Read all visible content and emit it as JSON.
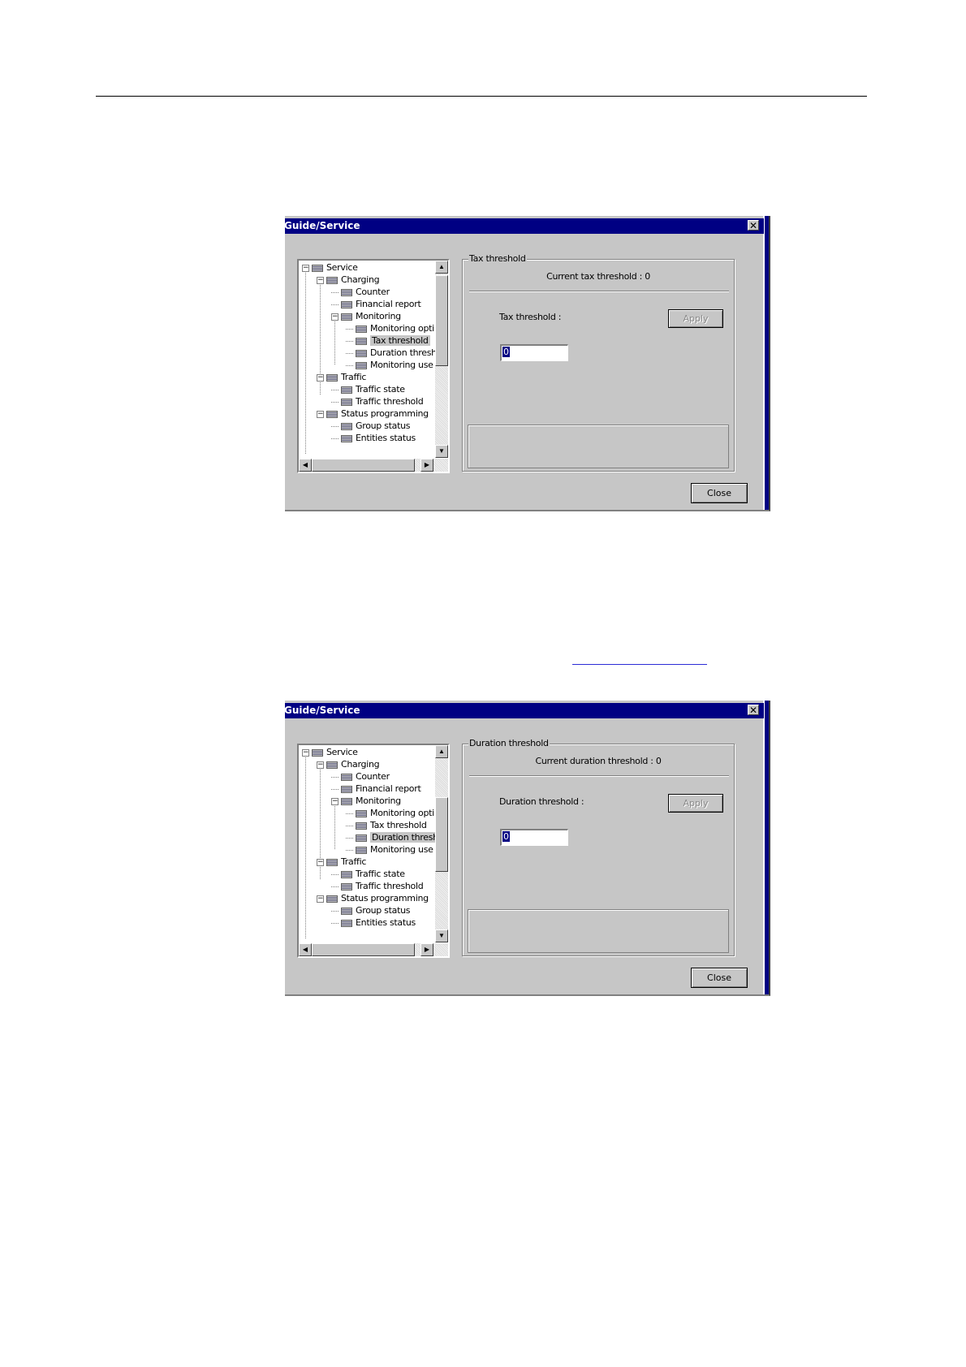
{
  "dialogs": [
    {
      "title": "Guide/Service",
      "close_glyph": "✕",
      "tree": {
        "items": [
          {
            "label": "Service",
            "level": 0,
            "expander": "−"
          },
          {
            "label": "Charging",
            "level": 1,
            "expander": "−"
          },
          {
            "label": "Counter",
            "level": 2
          },
          {
            "label": "Financial report",
            "level": 2
          },
          {
            "label": "Monitoring",
            "level": 2,
            "expander": "−"
          },
          {
            "label": "Monitoring opti",
            "level": 3
          },
          {
            "label": "Tax threshold",
            "level": 3,
            "selected": true
          },
          {
            "label": "Duration thresh",
            "level": 3
          },
          {
            "label": "Monitoring use",
            "level": 3
          },
          {
            "label": "Traffic",
            "level": 1,
            "expander": "−"
          },
          {
            "label": "Traffic state",
            "level": 2
          },
          {
            "label": "Traffic threshold",
            "level": 2
          },
          {
            "label": "Status programming",
            "level": 1,
            "expander": "−"
          },
          {
            "label": "Group status",
            "level": 2
          },
          {
            "label": "Entities status",
            "level": 2
          }
        ],
        "scroll_up_glyph": "▲",
        "scroll_down_glyph": "▼",
        "scroll_left_glyph": "◀",
        "scroll_right_glyph": "▶"
      },
      "group": {
        "title": "Tax threshold",
        "current_text": "Current tax threshold : 0",
        "field_label": "Tax threshold :",
        "apply_label": "Apply",
        "input_value": "0"
      },
      "close_label": "Close"
    },
    {
      "title": "Guide/Service",
      "close_glyph": "✕",
      "tree": {
        "items": [
          {
            "label": "Service",
            "level": 0,
            "expander": "−"
          },
          {
            "label": "Charging",
            "level": 1,
            "expander": "−"
          },
          {
            "label": "Counter",
            "level": 2
          },
          {
            "label": "Financial report",
            "level": 2
          },
          {
            "label": "Monitoring",
            "level": 2,
            "expander": "−"
          },
          {
            "label": "Monitoring opti",
            "level": 3
          },
          {
            "label": "Tax threshold",
            "level": 3
          },
          {
            "label": "Duration thresh",
            "level": 3,
            "selected": true
          },
          {
            "label": "Monitoring use",
            "level": 3
          },
          {
            "label": "Traffic",
            "level": 1,
            "expander": "−"
          },
          {
            "label": "Traffic state",
            "level": 2
          },
          {
            "label": "Traffic threshold",
            "level": 2
          },
          {
            "label": "Status programming",
            "level": 1,
            "expander": "−"
          },
          {
            "label": "Group status",
            "level": 2
          },
          {
            "label": "Entities status",
            "level": 2
          }
        ],
        "scroll_up_glyph": "▲",
        "scroll_down_glyph": "▼",
        "scroll_left_glyph": "◀",
        "scroll_right_glyph": "▶"
      },
      "group": {
        "title": "Duration threshold",
        "current_text": "Current duration threshold : 0",
        "field_label": "Duration threshold :",
        "apply_label": "Apply",
        "input_value": "0"
      },
      "close_label": "Close"
    }
  ],
  "colors": {
    "title_bar": "#000083",
    "dialog_face": "#c6c6c6",
    "link": "#2b2bd6"
  }
}
